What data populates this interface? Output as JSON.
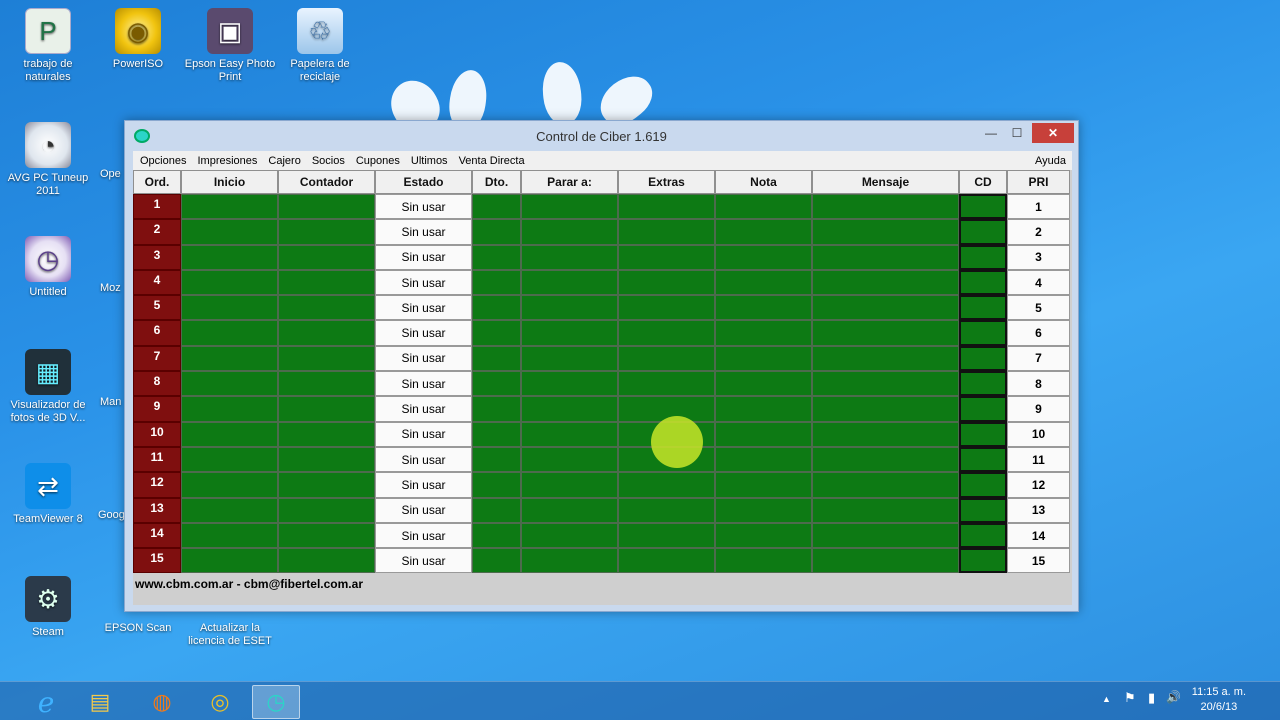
{
  "desktop": {
    "icons": [
      {
        "label": "trabajo de naturales",
        "glyph": "P"
      },
      {
        "label": "PowerISO",
        "glyph": "◉"
      },
      {
        "label": "Epson Easy Photo Print",
        "glyph": "▣"
      },
      {
        "label": "Papelera de reciclaje",
        "glyph": "♲"
      },
      {
        "label": "AVG PC Tuneup 2011",
        "glyph": "◔"
      },
      {
        "label": "Untitled",
        "glyph": "◷"
      },
      {
        "label": "Visualizador de fotos de 3D V...",
        "glyph": "▦"
      },
      {
        "label": "TeamViewer 8",
        "glyph": "⇄"
      },
      {
        "label": "Steam",
        "glyph": "⚙"
      },
      {
        "label": "EPSON Scan",
        "glyph": ""
      },
      {
        "label": "Actualizar la licencia de ESET",
        "glyph": ""
      }
    ],
    "partial_labels": [
      "Ope",
      "Moz",
      "Man",
      "Goog"
    ]
  },
  "window": {
    "title": "Control de Ciber 1.619",
    "minimize": "—",
    "maximize": "☐",
    "close": "✕",
    "menu": [
      "Opciones",
      "Impresiones",
      "Cajero",
      "Socios",
      "Cupones",
      "Ultimos",
      "Venta Directa"
    ],
    "help": "Ayuda",
    "columns": [
      "Ord.",
      "Inicio",
      "Contador",
      "Estado",
      "Dto.",
      "Parar a:",
      "Extras",
      "Nota",
      "Mensaje",
      "CD",
      "PRI"
    ],
    "rows": [
      {
        "ord": "1",
        "estado": "Sin usar",
        "pri": "1"
      },
      {
        "ord": "2",
        "estado": "Sin usar",
        "pri": "2"
      },
      {
        "ord": "3",
        "estado": "Sin usar",
        "pri": "3"
      },
      {
        "ord": "4",
        "estado": "Sin usar",
        "pri": "4"
      },
      {
        "ord": "5",
        "estado": "Sin usar",
        "pri": "5"
      },
      {
        "ord": "6",
        "estado": "Sin usar",
        "pri": "6"
      },
      {
        "ord": "7",
        "estado": "Sin usar",
        "pri": "7"
      },
      {
        "ord": "8",
        "estado": "Sin usar",
        "pri": "8"
      },
      {
        "ord": "9",
        "estado": "Sin usar",
        "pri": "9"
      },
      {
        "ord": "10",
        "estado": "Sin usar",
        "pri": "10"
      },
      {
        "ord": "11",
        "estado": "Sin usar",
        "pri": "11"
      },
      {
        "ord": "12",
        "estado": "Sin usar",
        "pri": "12"
      },
      {
        "ord": "13",
        "estado": "Sin usar",
        "pri": "13"
      },
      {
        "ord": "14",
        "estado": "Sin usar",
        "pri": "14"
      },
      {
        "ord": "15",
        "estado": "Sin usar",
        "pri": "15"
      }
    ],
    "footer": "www.cbm.com.ar - cbm@fibertel.com.ar"
  },
  "taskbar": {
    "apps": [
      {
        "name": "internet-explorer",
        "glyph": "e"
      },
      {
        "name": "file-explorer",
        "glyph": "▤"
      },
      {
        "name": "firefox",
        "glyph": "◍"
      },
      {
        "name": "chrome",
        "glyph": "◎"
      },
      {
        "name": "control-de-ciber",
        "glyph": "◷"
      }
    ],
    "tray": {
      "chevron": "▲",
      "flag": "⚑",
      "network": "▮",
      "volume": "🔊"
    },
    "time": "11:15 a. m.",
    "date": "20/6/13"
  },
  "colors": {
    "ord_cell": "#7f0f0f",
    "grid_green": "#0d7a14",
    "desktop_blue": "#2a92e8",
    "close_button": "#c7403a"
  }
}
